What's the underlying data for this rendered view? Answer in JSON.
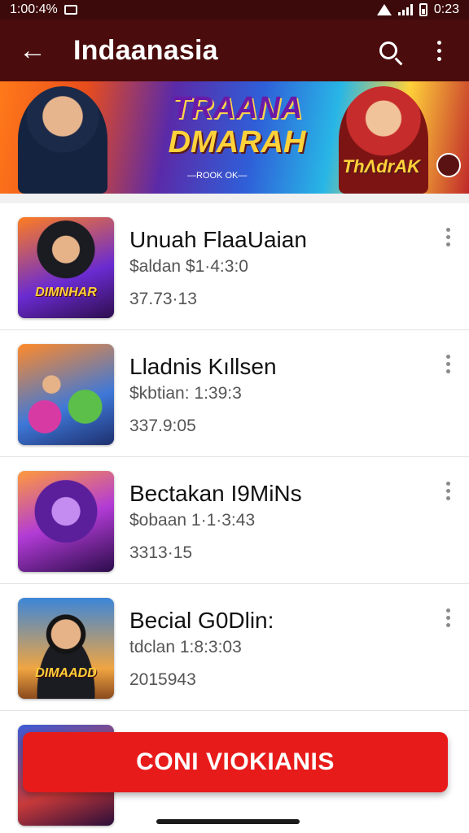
{
  "status_bar": {
    "left_text": "1:00:4%",
    "time": "0:23"
  },
  "app_bar": {
    "back_glyph": "←",
    "title": "Indaanasia"
  },
  "banner": {
    "title_line1": "TRAANA",
    "title_line2": "DMARAH",
    "tagline": "—ROOK OK—",
    "right_logo": "ThΛdrAK"
  },
  "items": [
    {
      "title": "Unuah FlaaUaian",
      "subtitle": "$aldan $1·4:3:0",
      "meta": "37.73·13",
      "thumb_caption": "DIMNHAR"
    },
    {
      "title": "Lladnis Kıllsen",
      "subtitle": "$kbtian: 1:39:3",
      "meta": "337.9:05",
      "thumb_caption": ""
    },
    {
      "title": "Bectakan I9MiNs",
      "subtitle": "$obaan 1·1·3:43",
      "meta": "3313·15",
      "thumb_caption": ""
    },
    {
      "title": "Becial G0Dlin:",
      "subtitle": "tdclan 1:8:3:03",
      "meta": "2015943",
      "thumb_caption": "DIMAADD"
    }
  ],
  "cta": {
    "label": "CONI VIOKIANIS"
  }
}
